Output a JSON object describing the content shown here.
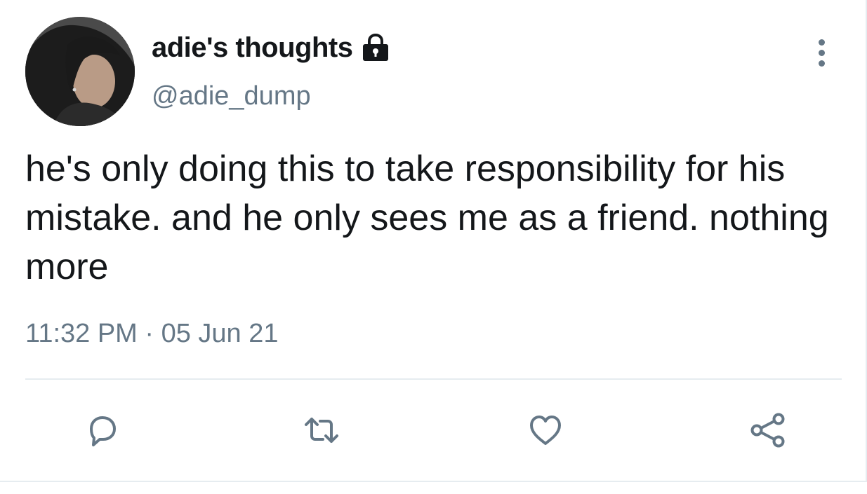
{
  "user": {
    "display_name": "adie's thoughts",
    "handle": "@adie_dump",
    "protected_icon": "lock-icon",
    "avatar": "profile-photo"
  },
  "tweet": {
    "text": "he's only doing this to take responsibility for his mistake. and he only sees me as a friend. nothing more",
    "timestamp": "11:32 PM · 05 Jun 21"
  },
  "actions": [
    {
      "name": "reply",
      "icon": "reply-icon"
    },
    {
      "name": "retweet",
      "icon": "retweet-icon"
    },
    {
      "name": "like",
      "icon": "heart-icon"
    },
    {
      "name": "share",
      "icon": "share-icon"
    }
  ],
  "menu_icon": "more-vertical-icon",
  "colors": {
    "text": "#14171a",
    "secondary": "#657786",
    "divider": "#e6ecf0"
  }
}
